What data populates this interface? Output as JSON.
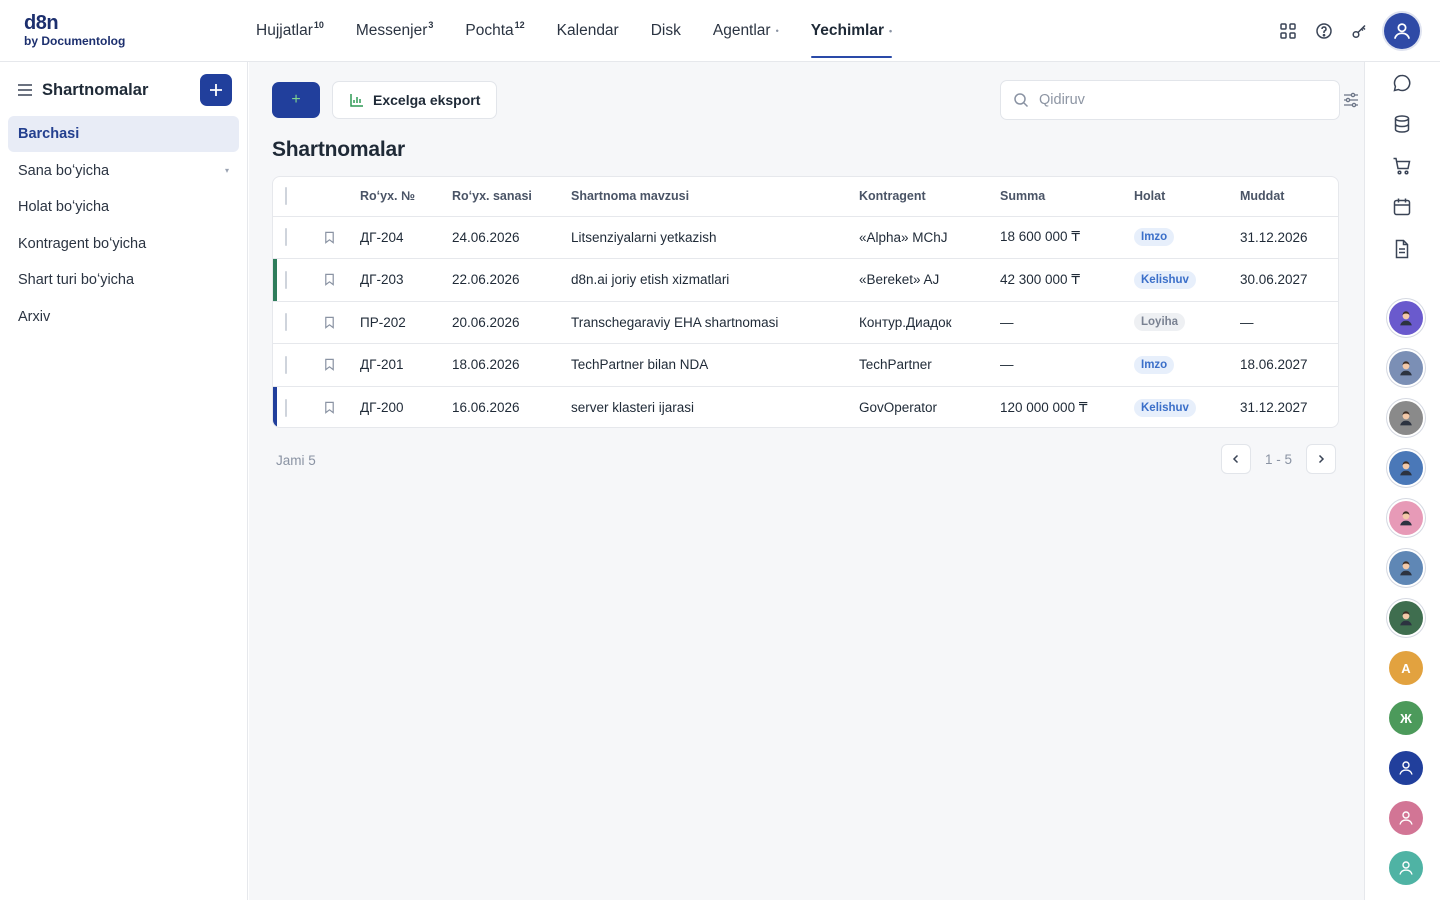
{
  "brand": {
    "name": "d8n",
    "sub": "by Documentolog"
  },
  "nav": [
    {
      "label": "Hujjatlar",
      "badge": "10"
    },
    {
      "label": "Messenjer",
      "badge": "3"
    },
    {
      "label": "Pochta",
      "badge": "12"
    },
    {
      "label": "Kalendar"
    },
    {
      "label": "Disk"
    },
    {
      "label": "Agentlar",
      "dropdown": "•"
    },
    {
      "label": "Yechimlar",
      "dropdown": "•",
      "active": true
    }
  ],
  "sidebar": {
    "title": "Shartnomalar",
    "items": [
      {
        "label": "Barchasi",
        "active": true
      },
      {
        "label": "Sana boʻyicha",
        "chevron": "▾"
      },
      {
        "label": "Holat boʻyicha"
      },
      {
        "label": "Kontragent boʻyicha"
      },
      {
        "label": "Shart turi boʻyicha"
      },
      {
        "label": "Arxiv"
      }
    ]
  },
  "toolbar": {
    "new_label": "+",
    "export_label": "Excelga eksport",
    "search_placeholder": "Qidiruv"
  },
  "page_title": "Shartnomalar",
  "table": {
    "columns": [
      "Roʻyx. №",
      "Roʻyx. sanasi",
      "Shartnoma mavzusi",
      "Kontragent",
      "Summa",
      "Holat",
      "Muddat"
    ],
    "rows": [
      {
        "num": "ДГ-204",
        "date": "24.06.2026",
        "subject": "Litsenziyalarni yetkazish",
        "party": "«Alpha» MChJ",
        "sum": "18 600 000 ₸",
        "status": "Imzo",
        "status_color": "blue",
        "due": "31.12.2026",
        "stripe": ""
      },
      {
        "num": "ДГ-203",
        "date": "22.06.2026",
        "subject": "d8n.ai joriy etish xizmatlari",
        "party": "«Bereket» AJ",
        "sum": "42 300 000 ₸",
        "status": "Kelishuv",
        "status_color": "blue",
        "due": "30.06.2027",
        "stripe": "#2e7d5b"
      },
      {
        "num": "ПР-202",
        "date": "20.06.2026",
        "subject": "Transchegaraviy EHA shartnomasi",
        "party": "Контур.Диадок",
        "sum": "—",
        "status": "Loyiha",
        "status_color": "gray",
        "due": "—",
        "stripe": ""
      },
      {
        "num": "ДГ-201",
        "date": "18.06.2026",
        "subject": "TechPartner bilan NDA",
        "party": "TechPartner",
        "sum": "—",
        "status": "Imzo",
        "status_color": "blue",
        "due": "18.06.2027",
        "stripe": ""
      },
      {
        "num": "ДГ-200",
        "date": "16.06.2026",
        "subject": "server klasteri ijarasi",
        "party": "GovOperator",
        "sum": "120 000 000 ₸",
        "status": "Kelishuv",
        "status_color": "blue",
        "due": "31.12.2027",
        "stripe": "#213f9c"
      }
    ]
  },
  "footer": {
    "total": "Jami 5",
    "range": "1 - 5"
  },
  "rail": {
    "avatars": [
      {
        "type": "photo",
        "color": "#6a5acd"
      },
      {
        "type": "photo",
        "color": "#7b8fb5"
      },
      {
        "type": "photo",
        "color": "#8a8a8a"
      },
      {
        "type": "photo",
        "color": "#4a78b8"
      },
      {
        "type": "photo",
        "color": "#e79ab7"
      },
      {
        "type": "photo",
        "color": "#5f87b5"
      },
      {
        "type": "photo",
        "color": "#3f6e4f"
      },
      {
        "type": "letter",
        "letter": "A",
        "color": "#e2a23f"
      },
      {
        "type": "letter",
        "letter": "Ж",
        "color": "#4c9a5b"
      },
      {
        "type": "user",
        "color": "#213f9c"
      },
      {
        "type": "user",
        "color": "#d27595"
      },
      {
        "type": "user",
        "color": "#4fb3a4"
      }
    ]
  }
}
